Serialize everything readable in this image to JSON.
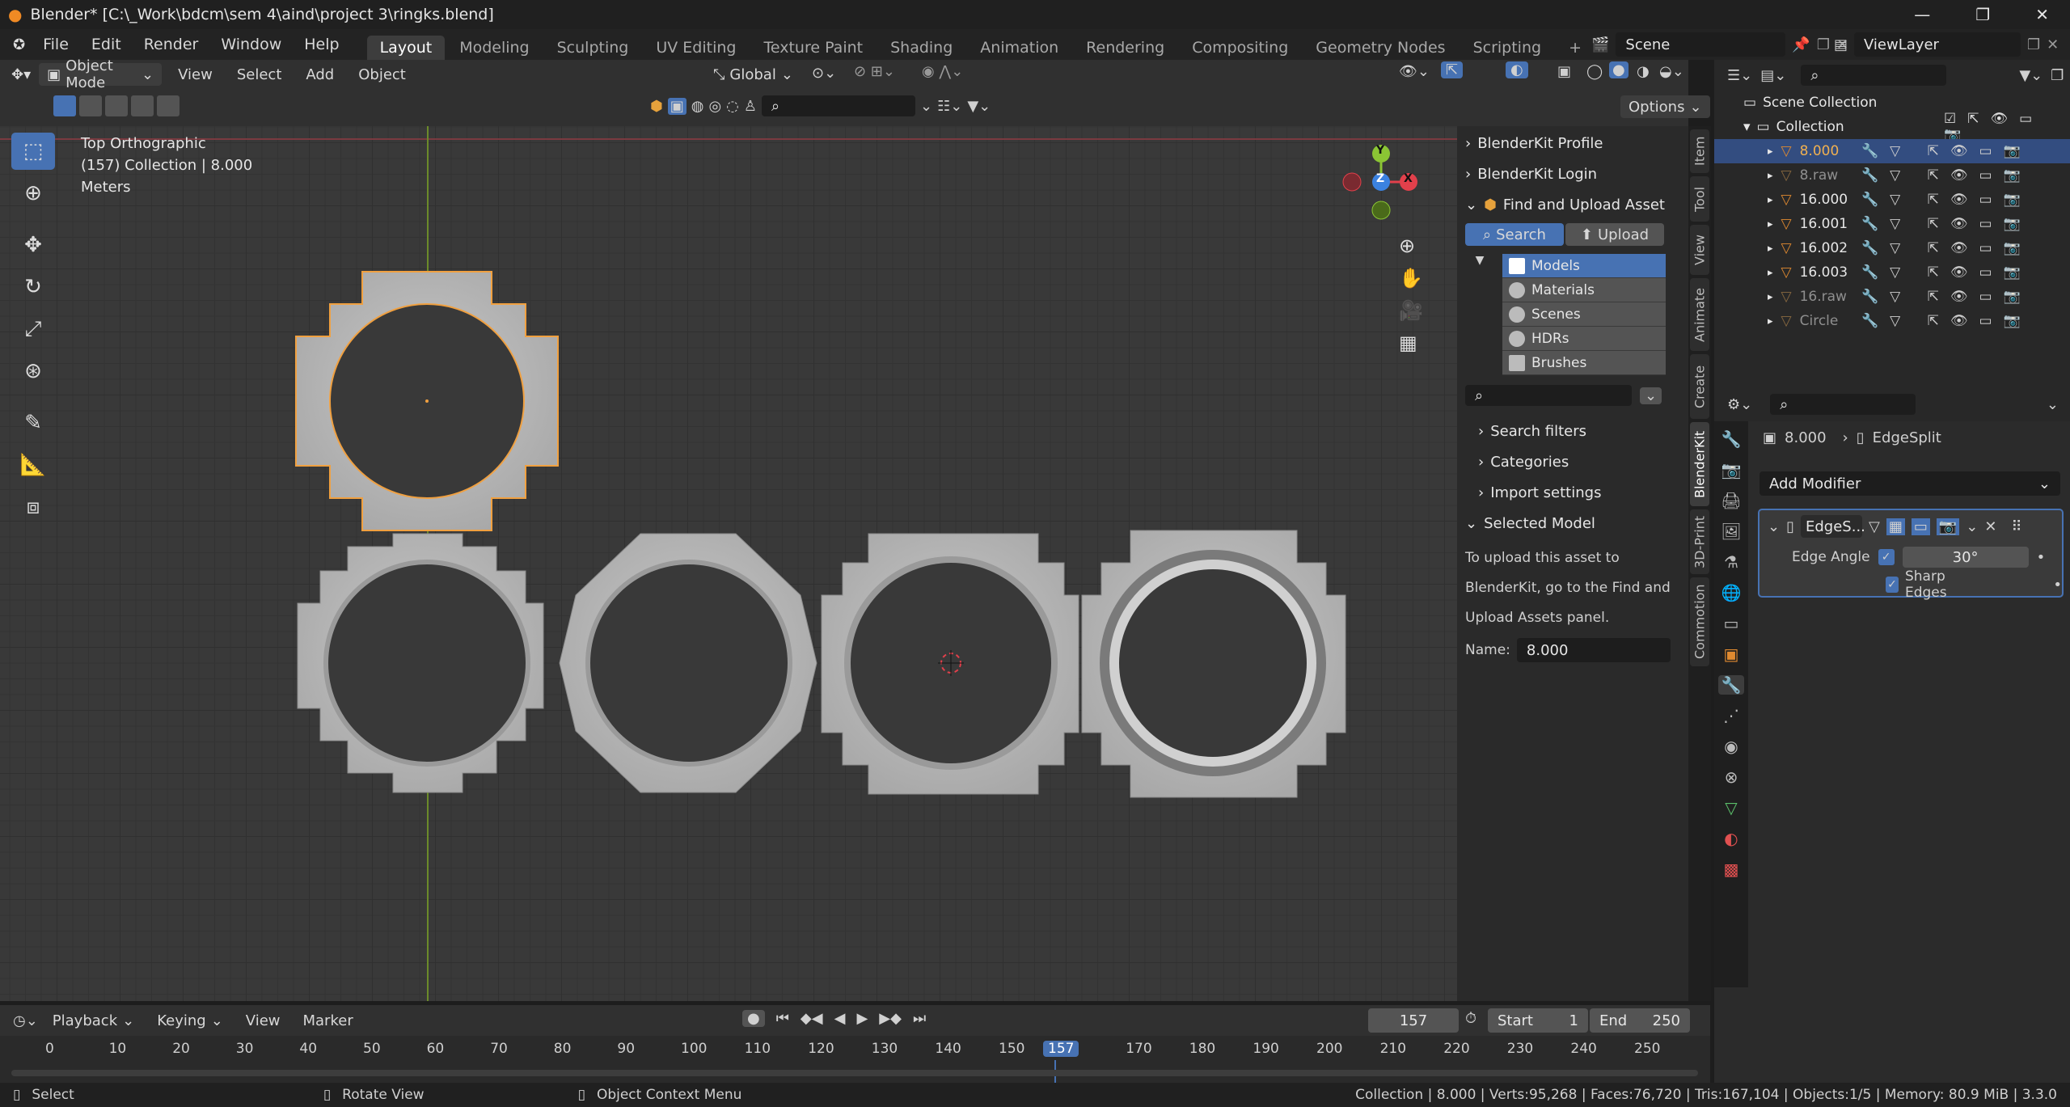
{
  "window": {
    "title": "Blender* [C:\\_Work\\bdcm\\sem 4\\aind\\project 3\\ringks.blend]"
  },
  "menu": {
    "items": [
      "File",
      "Edit",
      "Render",
      "Window",
      "Help"
    ]
  },
  "workspaces": [
    "Layout",
    "Modeling",
    "Sculpting",
    "UV Editing",
    "Texture Paint",
    "Shading",
    "Animation",
    "Rendering",
    "Compositing",
    "Geometry Nodes",
    "Scripting"
  ],
  "scene": {
    "name": "Scene",
    "view_layer": "ViewLayer"
  },
  "viewport_header": {
    "mode": "Object Mode",
    "menus": [
      "View",
      "Select",
      "Add",
      "Object"
    ],
    "orientation": "Global",
    "options": "Options"
  },
  "viewport": {
    "view_name": "Top Orthographic",
    "collection_info": "(157) Collection | 8.000",
    "units": "Meters",
    "gizmo": {
      "y": "Y",
      "z": "Z",
      "x": "X"
    }
  },
  "colors": {
    "accent": "#4772b3",
    "selected_outline": "#f0a040",
    "x_axis": "#e2404b",
    "y_axis": "#8bc534",
    "z_axis": "#3b82e0"
  },
  "npanel": {
    "profile": "BlenderKit Profile",
    "login": "BlenderKit Login",
    "find_upload": "Find and Upload Asset",
    "search_tab": "Search",
    "upload_tab": "Upload",
    "asset_types": [
      "Models",
      "Materials",
      "Scenes",
      "HDRs",
      "Brushes"
    ],
    "search_filters": "Search filters",
    "categories": "Categories",
    "import_settings": "Import settings",
    "selected_model": "Selected Model",
    "upload_text": [
      "To upload this asset to",
      "BlenderKit, go to the Find and",
      "Upload Assets panel."
    ],
    "name_label": "Name:",
    "name_value": "8.000"
  },
  "side_tabs": [
    "Item",
    "Tool",
    "View",
    "Animate",
    "Create",
    "BlenderKit",
    "3D-Print",
    "Commotion"
  ],
  "outliner": {
    "scene_collection": "Scene Collection",
    "collection": "Collection",
    "objects": [
      {
        "name": "8.000",
        "dim": false,
        "selected": true
      },
      {
        "name": "8.raw",
        "dim": true,
        "selected": false
      },
      {
        "name": "16.000",
        "dim": false,
        "selected": false
      },
      {
        "name": "16.001",
        "dim": false,
        "selected": false
      },
      {
        "name": "16.002",
        "dim": false,
        "selected": false
      },
      {
        "name": "16.003",
        "dim": false,
        "selected": false
      },
      {
        "name": "16.raw",
        "dim": true,
        "selected": false
      },
      {
        "name": "Circle",
        "dim": true,
        "selected": false
      }
    ]
  },
  "properties": {
    "object": "8.000",
    "modifier_path": "EdgeSplit",
    "add_modifier": "Add Modifier",
    "modifier_name": "EdgeS...",
    "edge_angle_label": "Edge Angle",
    "edge_angle_value": "30°",
    "sharp_edges": "Sharp Edges"
  },
  "timeline": {
    "menus": [
      "Playback",
      "Keying",
      "View",
      "Marker"
    ],
    "current_frame": "157",
    "start_label": "Start",
    "start": "1",
    "end_label": "End",
    "end": "250",
    "ticks": [
      "0",
      "10",
      "20",
      "30",
      "40",
      "50",
      "60",
      "70",
      "80",
      "90",
      "100",
      "110",
      "120",
      "130",
      "140",
      "150",
      "157",
      "170",
      "180",
      "190",
      "200",
      "210",
      "220",
      "230",
      "240",
      "250"
    ]
  },
  "status": {
    "select": "Select",
    "rotate": "Rotate View",
    "context": "Object Context Menu",
    "stats": "Collection | 8.000 | Verts:95,268 | Faces:76,720 | Tris:167,104 | Objects:1/5 | Memory: 80.9 MiB | 3.3.0"
  }
}
